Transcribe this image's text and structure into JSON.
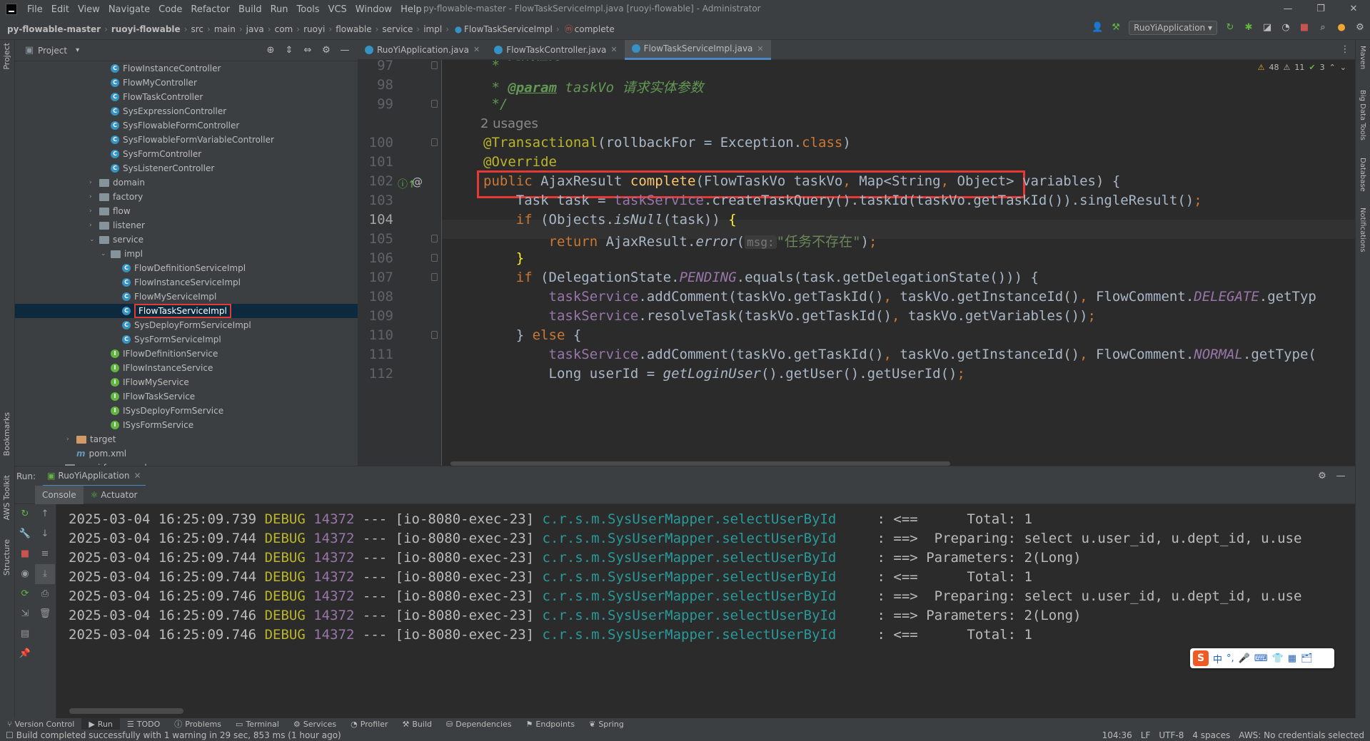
{
  "window": {
    "title": "py-flowable-master - FlowTaskServiceImpl.java [ruoyi-flowable] - Administrator",
    "menu": [
      "File",
      "Edit",
      "View",
      "Navigate",
      "Code",
      "Refactor",
      "Build",
      "Run",
      "Tools",
      "VCS",
      "Window",
      "Help"
    ],
    "controls": [
      "—",
      "❐",
      "✕"
    ]
  },
  "breadcrumb": [
    "py-flowable-master",
    "ruoyi-flowable",
    "src",
    "main",
    "java",
    "com",
    "ruoyi",
    "flowable",
    "service",
    "impl",
    "FlowTaskServiceImpl",
    "complete"
  ],
  "toolbar": {
    "run_config": "RuoYiApplication"
  },
  "left_strip": [
    "Project",
    "Bookmarks",
    "AWS Toolkit",
    "Structure"
  ],
  "right_strip": [
    "Maven",
    "Big Data Tools",
    "Database",
    "Notifications"
  ],
  "project": {
    "header": "Project",
    "tree": [
      {
        "label": "FlowInstanceController",
        "type": "class",
        "indent": 3
      },
      {
        "label": "FlowMyController",
        "type": "class",
        "indent": 3
      },
      {
        "label": "FlowTaskController",
        "type": "class",
        "indent": 3
      },
      {
        "label": "SysExpressionController",
        "type": "class",
        "indent": 3
      },
      {
        "label": "SysFlowableFormController",
        "type": "class",
        "indent": 3
      },
      {
        "label": "SysFlowableFormVariableController",
        "type": "class",
        "indent": 3
      },
      {
        "label": "SysFormController",
        "type": "class",
        "indent": 3
      },
      {
        "label": "SysListenerController",
        "type": "class",
        "indent": 3
      },
      {
        "label": "domain",
        "type": "folder",
        "indent": 2,
        "arrow": "›"
      },
      {
        "label": "factory",
        "type": "folder",
        "indent": 2,
        "arrow": "›"
      },
      {
        "label": "flow",
        "type": "folder",
        "indent": 2,
        "arrow": "›"
      },
      {
        "label": "listener",
        "type": "folder",
        "indent": 2,
        "arrow": "›"
      },
      {
        "label": "service",
        "type": "folder",
        "indent": 2,
        "arrow": "⌄"
      },
      {
        "label": "impl",
        "type": "folder",
        "indent": 3,
        "arrow": "⌄"
      },
      {
        "label": "FlowDefinitionServiceImpl",
        "type": "class",
        "indent": 4
      },
      {
        "label": "FlowInstanceServiceImpl",
        "type": "class",
        "indent": 4
      },
      {
        "label": "FlowMyServiceImpl",
        "type": "class",
        "indent": 4
      },
      {
        "label": "FlowTaskServiceImpl",
        "type": "class",
        "indent": 4,
        "selected": true
      },
      {
        "label": "SysDeployFormServiceImpl",
        "type": "class",
        "indent": 4
      },
      {
        "label": "SysFormServiceImpl",
        "type": "class",
        "indent": 4
      },
      {
        "label": "IFlowDefinitionService",
        "type": "interface",
        "indent": 3
      },
      {
        "label": "IFlowInstanceService",
        "type": "interface",
        "indent": 3
      },
      {
        "label": "IFlowMyService",
        "type": "interface",
        "indent": 3
      },
      {
        "label": "IFlowTaskService",
        "type": "interface",
        "indent": 3
      },
      {
        "label": "ISysDeployFormService",
        "type": "interface",
        "indent": 3
      },
      {
        "label": "ISysFormService",
        "type": "interface",
        "indent": 3
      },
      {
        "label": "target",
        "type": "folder-target",
        "indent": 0,
        "arrow": "›"
      },
      {
        "label": "pom.xml",
        "type": "file",
        "indent": 0
      },
      {
        "label": "ruoyi-framework",
        "type": "folder",
        "indent": -1,
        "arrow": "›"
      }
    ]
  },
  "tabs": [
    {
      "label": "RuoYiApplication.java",
      "active": false
    },
    {
      "label": "FlowTaskController.java",
      "active": false
    },
    {
      "label": "FlowTaskServiceImpl.java",
      "active": true
    }
  ],
  "inspections": {
    "warnings": "48",
    "weak": "11",
    "ok": "3"
  },
  "editor": {
    "line_numbers": [
      "97",
      "98",
      "99",
      "100",
      "101",
      "102",
      "103",
      "104",
      "105",
      "106",
      "107",
      "108",
      "109",
      "110",
      "111",
      "112"
    ],
    "usages": "2 usages",
    "hint_msg": "msg:"
  },
  "run": {
    "label": "Run:",
    "config": "RuoYiApplication",
    "subtabs": [
      "Console",
      "Actuator"
    ],
    "log": [
      {
        "ts": "2025-03-04 16:25:09.739",
        "level": "DEBUG",
        "pid": "14372",
        "thread": "--- [io-8080-exec-23]",
        "logger": "c.r.s.m.SysUserMapper.selectUserById",
        "msg": "     : <==      Total: 1"
      },
      {
        "ts": "2025-03-04 16:25:09.744",
        "level": "DEBUG",
        "pid": "14372",
        "thread": "--- [io-8080-exec-23]",
        "logger": "c.r.s.m.SysUserMapper.selectUserById",
        "msg": "     : ==>  Preparing: select u.user_id, u.dept_id, u.use"
      },
      {
        "ts": "2025-03-04 16:25:09.744",
        "level": "DEBUG",
        "pid": "14372",
        "thread": "--- [io-8080-exec-23]",
        "logger": "c.r.s.m.SysUserMapper.selectUserById",
        "msg": "     : ==> Parameters: 2(Long)"
      },
      {
        "ts": "2025-03-04 16:25:09.744",
        "level": "DEBUG",
        "pid": "14372",
        "thread": "--- [io-8080-exec-23]",
        "logger": "c.r.s.m.SysUserMapper.selectUserById",
        "msg": "     : <==      Total: 1"
      },
      {
        "ts": "2025-03-04 16:25:09.746",
        "level": "DEBUG",
        "pid": "14372",
        "thread": "--- [io-8080-exec-23]",
        "logger": "c.r.s.m.SysUserMapper.selectUserById",
        "msg": "     : ==>  Preparing: select u.user_id, u.dept_id, u.use"
      },
      {
        "ts": "2025-03-04 16:25:09.746",
        "level": "DEBUG",
        "pid": "14372",
        "thread": "--- [io-8080-exec-23]",
        "logger": "c.r.s.m.SysUserMapper.selectUserById",
        "msg": "     : ==> Parameters: 2(Long)"
      },
      {
        "ts": "2025-03-04 16:25:09.746",
        "level": "DEBUG",
        "pid": "14372",
        "thread": "--- [io-8080-exec-23]",
        "logger": "c.r.s.m.SysUserMapper.selectUserById",
        "msg": "     : <==      Total: 1"
      }
    ]
  },
  "toolwindows": [
    "Version Control",
    "Run",
    "TODO",
    "Problems",
    "Terminal",
    "Services",
    "Profiler",
    "Build",
    "Dependencies",
    "Endpoints",
    "Spring"
  ],
  "status": {
    "message": "Build completed successfully with 1 warning in 29 sec, 853 ms (1 hour ago)",
    "position": "104:36",
    "line_sep": "LF",
    "encoding": "UTF-8",
    "indent": "4 spaces",
    "aws": "AWS: No credentials selected"
  },
  "ime": {
    "logo": "S",
    "items": [
      "中",
      "°,",
      "🎤",
      "⌨",
      "👕",
      "▦",
      "🗂"
    ]
  }
}
